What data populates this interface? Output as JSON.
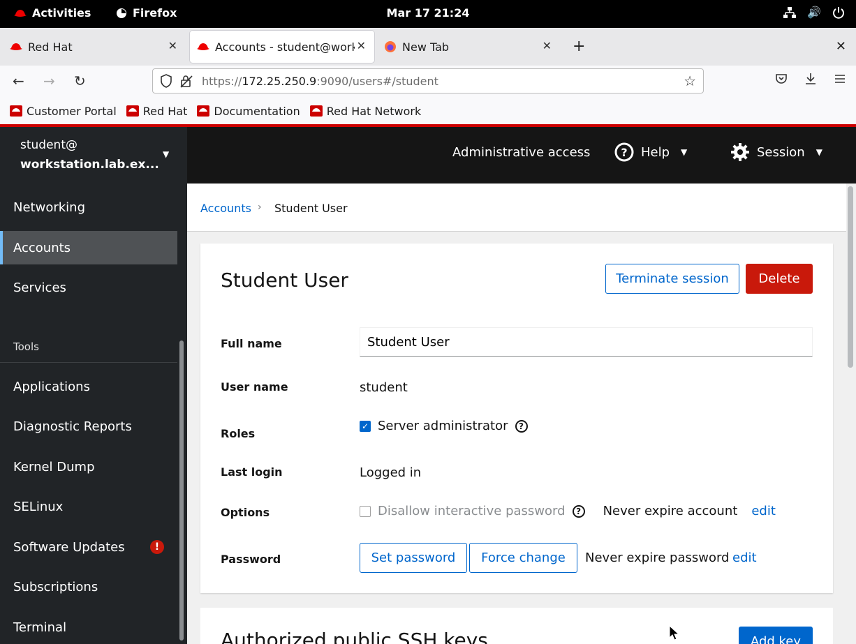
{
  "system_bar": {
    "activities": "Activities",
    "app": "Firefox",
    "clock": "Mar 17  21:24"
  },
  "browser": {
    "tabs": [
      {
        "title": "Red Hat",
        "icon": "redhat-icon"
      },
      {
        "title": "Accounts - student@work",
        "icon": "redhat-icon"
      },
      {
        "title": "New Tab",
        "icon": "firefox-icon"
      }
    ],
    "url_prefix": "https://",
    "url_host": "172.25.250.9",
    "url_rest": ":9090/users#/student",
    "bookmarks": [
      "Customer Portal",
      "Red Hat",
      "Documentation",
      "Red Hat Network"
    ]
  },
  "cockpit": {
    "host_user": "student@",
    "host_name": "workstation.lab.ex...",
    "admin_access": "Administrative access",
    "help": "Help",
    "session": "Session",
    "nav": [
      {
        "label": "Networking"
      },
      {
        "label": "Accounts",
        "active": true
      },
      {
        "label": "Services"
      }
    ],
    "tools_heading": "Tools",
    "tools": [
      {
        "label": "Applications"
      },
      {
        "label": "Diagnostic Reports"
      },
      {
        "label": "Kernel Dump"
      },
      {
        "label": "SELinux"
      },
      {
        "label": "Software Updates",
        "badge": "!"
      },
      {
        "label": "Subscriptions"
      },
      {
        "label": "Terminal"
      }
    ]
  },
  "breadcrumb": {
    "parent": "Accounts",
    "current": "Student User"
  },
  "account": {
    "title": "Student User",
    "terminate_label": "Terminate session",
    "delete_label": "Delete",
    "full_name_label": "Full name",
    "full_name_value": "Student User",
    "user_name_label": "User name",
    "user_name_value": "student",
    "roles_label": "Roles",
    "role_server_admin": "Server administrator",
    "role_checked": true,
    "last_login_label": "Last login",
    "last_login_value": "Logged in",
    "options_label": "Options",
    "disallow_label": "Disallow interactive password",
    "disallow_checked": false,
    "account_expiry": "Never expire account",
    "edit_label": "edit",
    "password_label": "Password",
    "set_password_label": "Set password",
    "force_change_label": "Force change",
    "password_expiry": "Never expire password"
  },
  "ssh": {
    "title": "Authorized public SSH keys",
    "add_key_label": "Add key"
  },
  "colors": {
    "accent": "#0066cc",
    "danger": "#c9190b",
    "brand": "#ee0000"
  }
}
